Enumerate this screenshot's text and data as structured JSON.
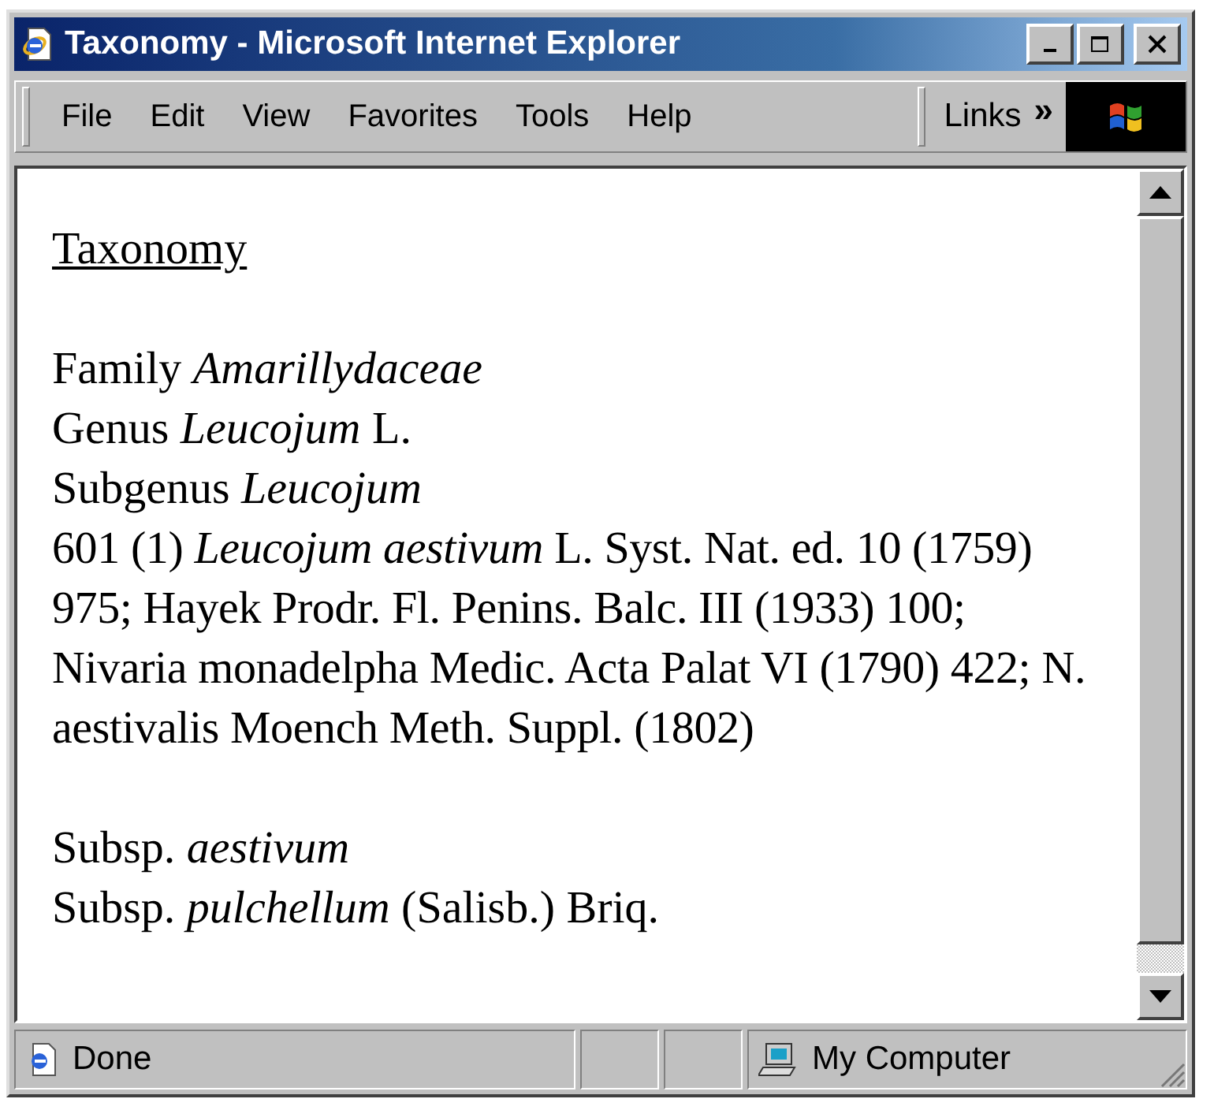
{
  "window": {
    "title": "Taxonomy - Microsoft Internet Explorer"
  },
  "menu": [
    "File",
    "Edit",
    "View",
    "Favorites",
    "Tools",
    "Help"
  ],
  "links": {
    "label": "Links",
    "chevron": "»"
  },
  "content": {
    "heading_link": "Taxonomy",
    "lines": [
      "Family *Amarillydaceae*",
      "Genus *Leucojum* L.",
      "Subgenus *Leucojum*"
    ],
    "paragraph": "601 (1) *Leucojum aestivum* L. Syst. Nat. ed. 10 (1759) 975; Hayek Prodr. Fl. Penins. Balc. III (1933) 100; Nivaria monadelpha Medic. Acta Palat VI (1790) 422; N. aestivalis Moench Meth. Suppl. (1802)",
    "subspecies": [
      "Subsp. *aestivum*",
      "Subsp. *pulchellum* (Salisb.) Briq."
    ]
  },
  "status_bar": {
    "status": "Done",
    "zone": "My Computer"
  }
}
